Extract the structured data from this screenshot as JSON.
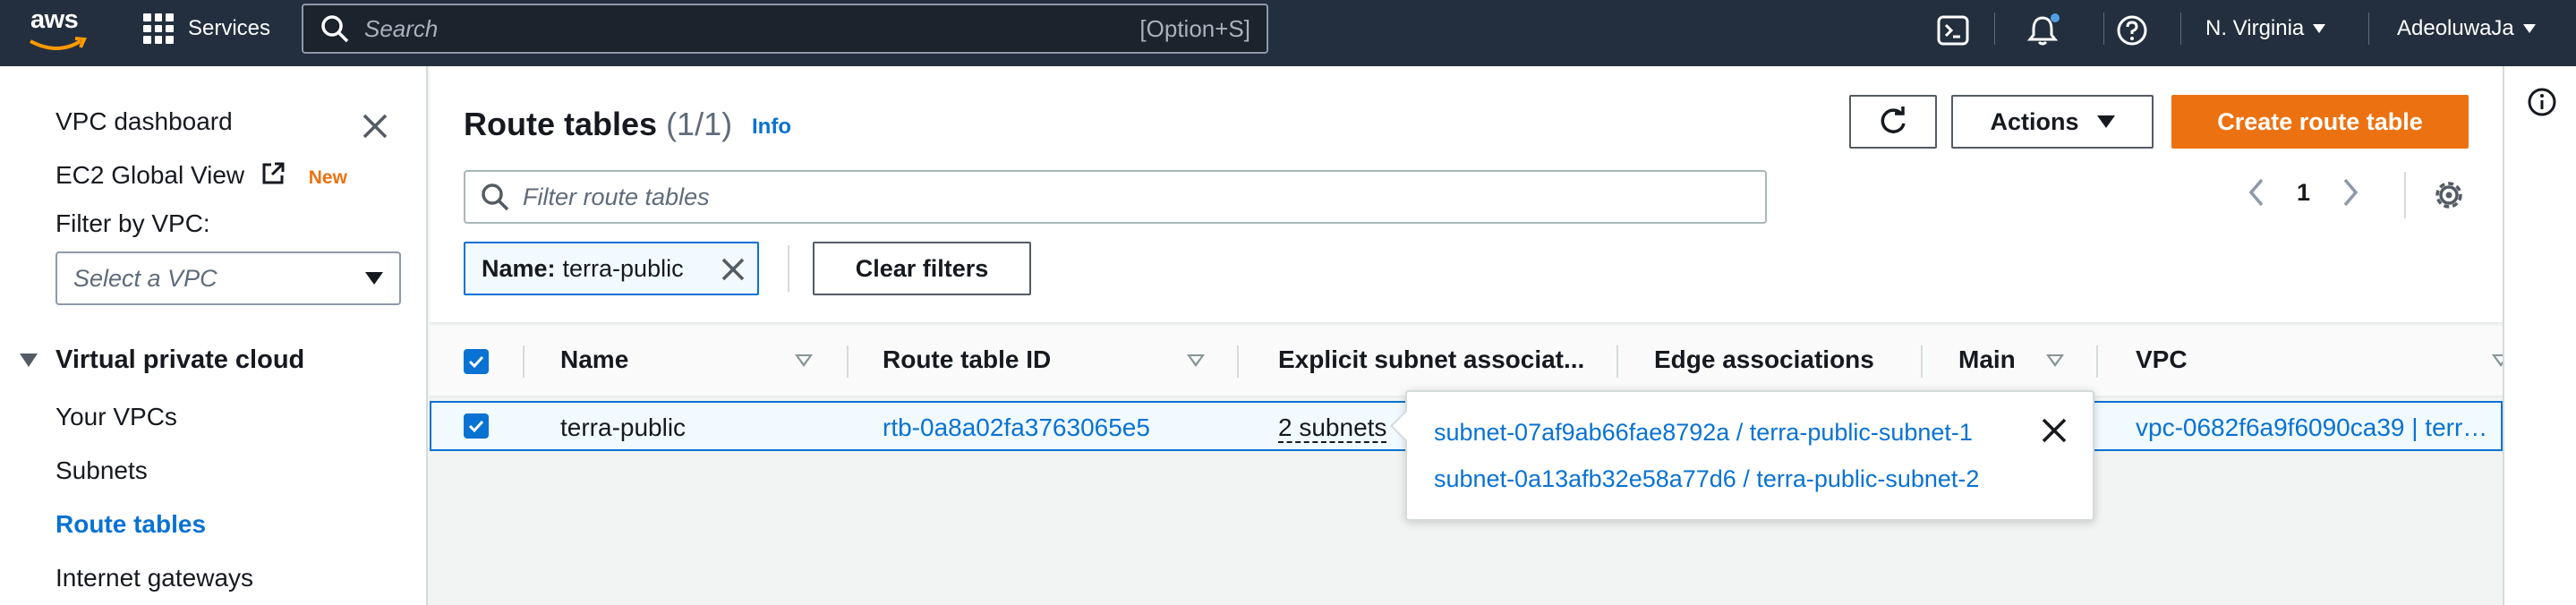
{
  "topnav": {
    "brand": "aws",
    "services_label": "Services",
    "search_placeholder": "Search",
    "search_shortcut": "[Option+S]",
    "icons": [
      "cloudshell-icon",
      "bell-icon",
      "help-icon"
    ],
    "region": "N. Virginia",
    "account": "AdeoluwaJa"
  },
  "sidebar": {
    "dashboard_label": "VPC dashboard",
    "ec2_global_label": "EC2 Global View",
    "new_badge": "New",
    "filter_label": "Filter by VPC:",
    "vpc_select_placeholder": "Select a VPC",
    "section_title": "Virtual private cloud",
    "items": [
      {
        "label": "Your VPCs",
        "active": false
      },
      {
        "label": "Subnets",
        "active": false
      },
      {
        "label": "Route tables",
        "active": true
      },
      {
        "label": "Internet gateways",
        "active": false
      }
    ]
  },
  "header": {
    "title": "Route tables",
    "count": "(1/1)",
    "info_link": "Info",
    "actions_label": "Actions",
    "create_label": "Create route table"
  },
  "filter": {
    "placeholder": "Filter route tables",
    "token_key": "Name:",
    "token_value": "terra-public",
    "clear_label": "Clear filters"
  },
  "pagination": {
    "current_page": "1"
  },
  "table": {
    "columns": [
      "Name",
      "Route table ID",
      "Explicit subnet associat...",
      "Edge associations",
      "Main",
      "VPC"
    ],
    "rows": [
      {
        "selected": true,
        "name": "terra-public",
        "route_table_id": "rtb-0a8a02fa3763065e5",
        "explicit_subnets": "2 subnets",
        "edge_associations": "",
        "main": "",
        "vpc": "vpc-0682f6a9f6090ca39 | terr…"
      }
    ]
  },
  "popover": {
    "subnets": [
      "subnet-07af9ab66fae8792a / terra-public-subnet-1",
      "subnet-0a13afb32e58a77d6 / terra-public-subnet-2"
    ]
  },
  "colors": {
    "nav_bg": "#232f3e",
    "accent_blue": "#0972d3",
    "primary_orange": "#ec7211"
  }
}
